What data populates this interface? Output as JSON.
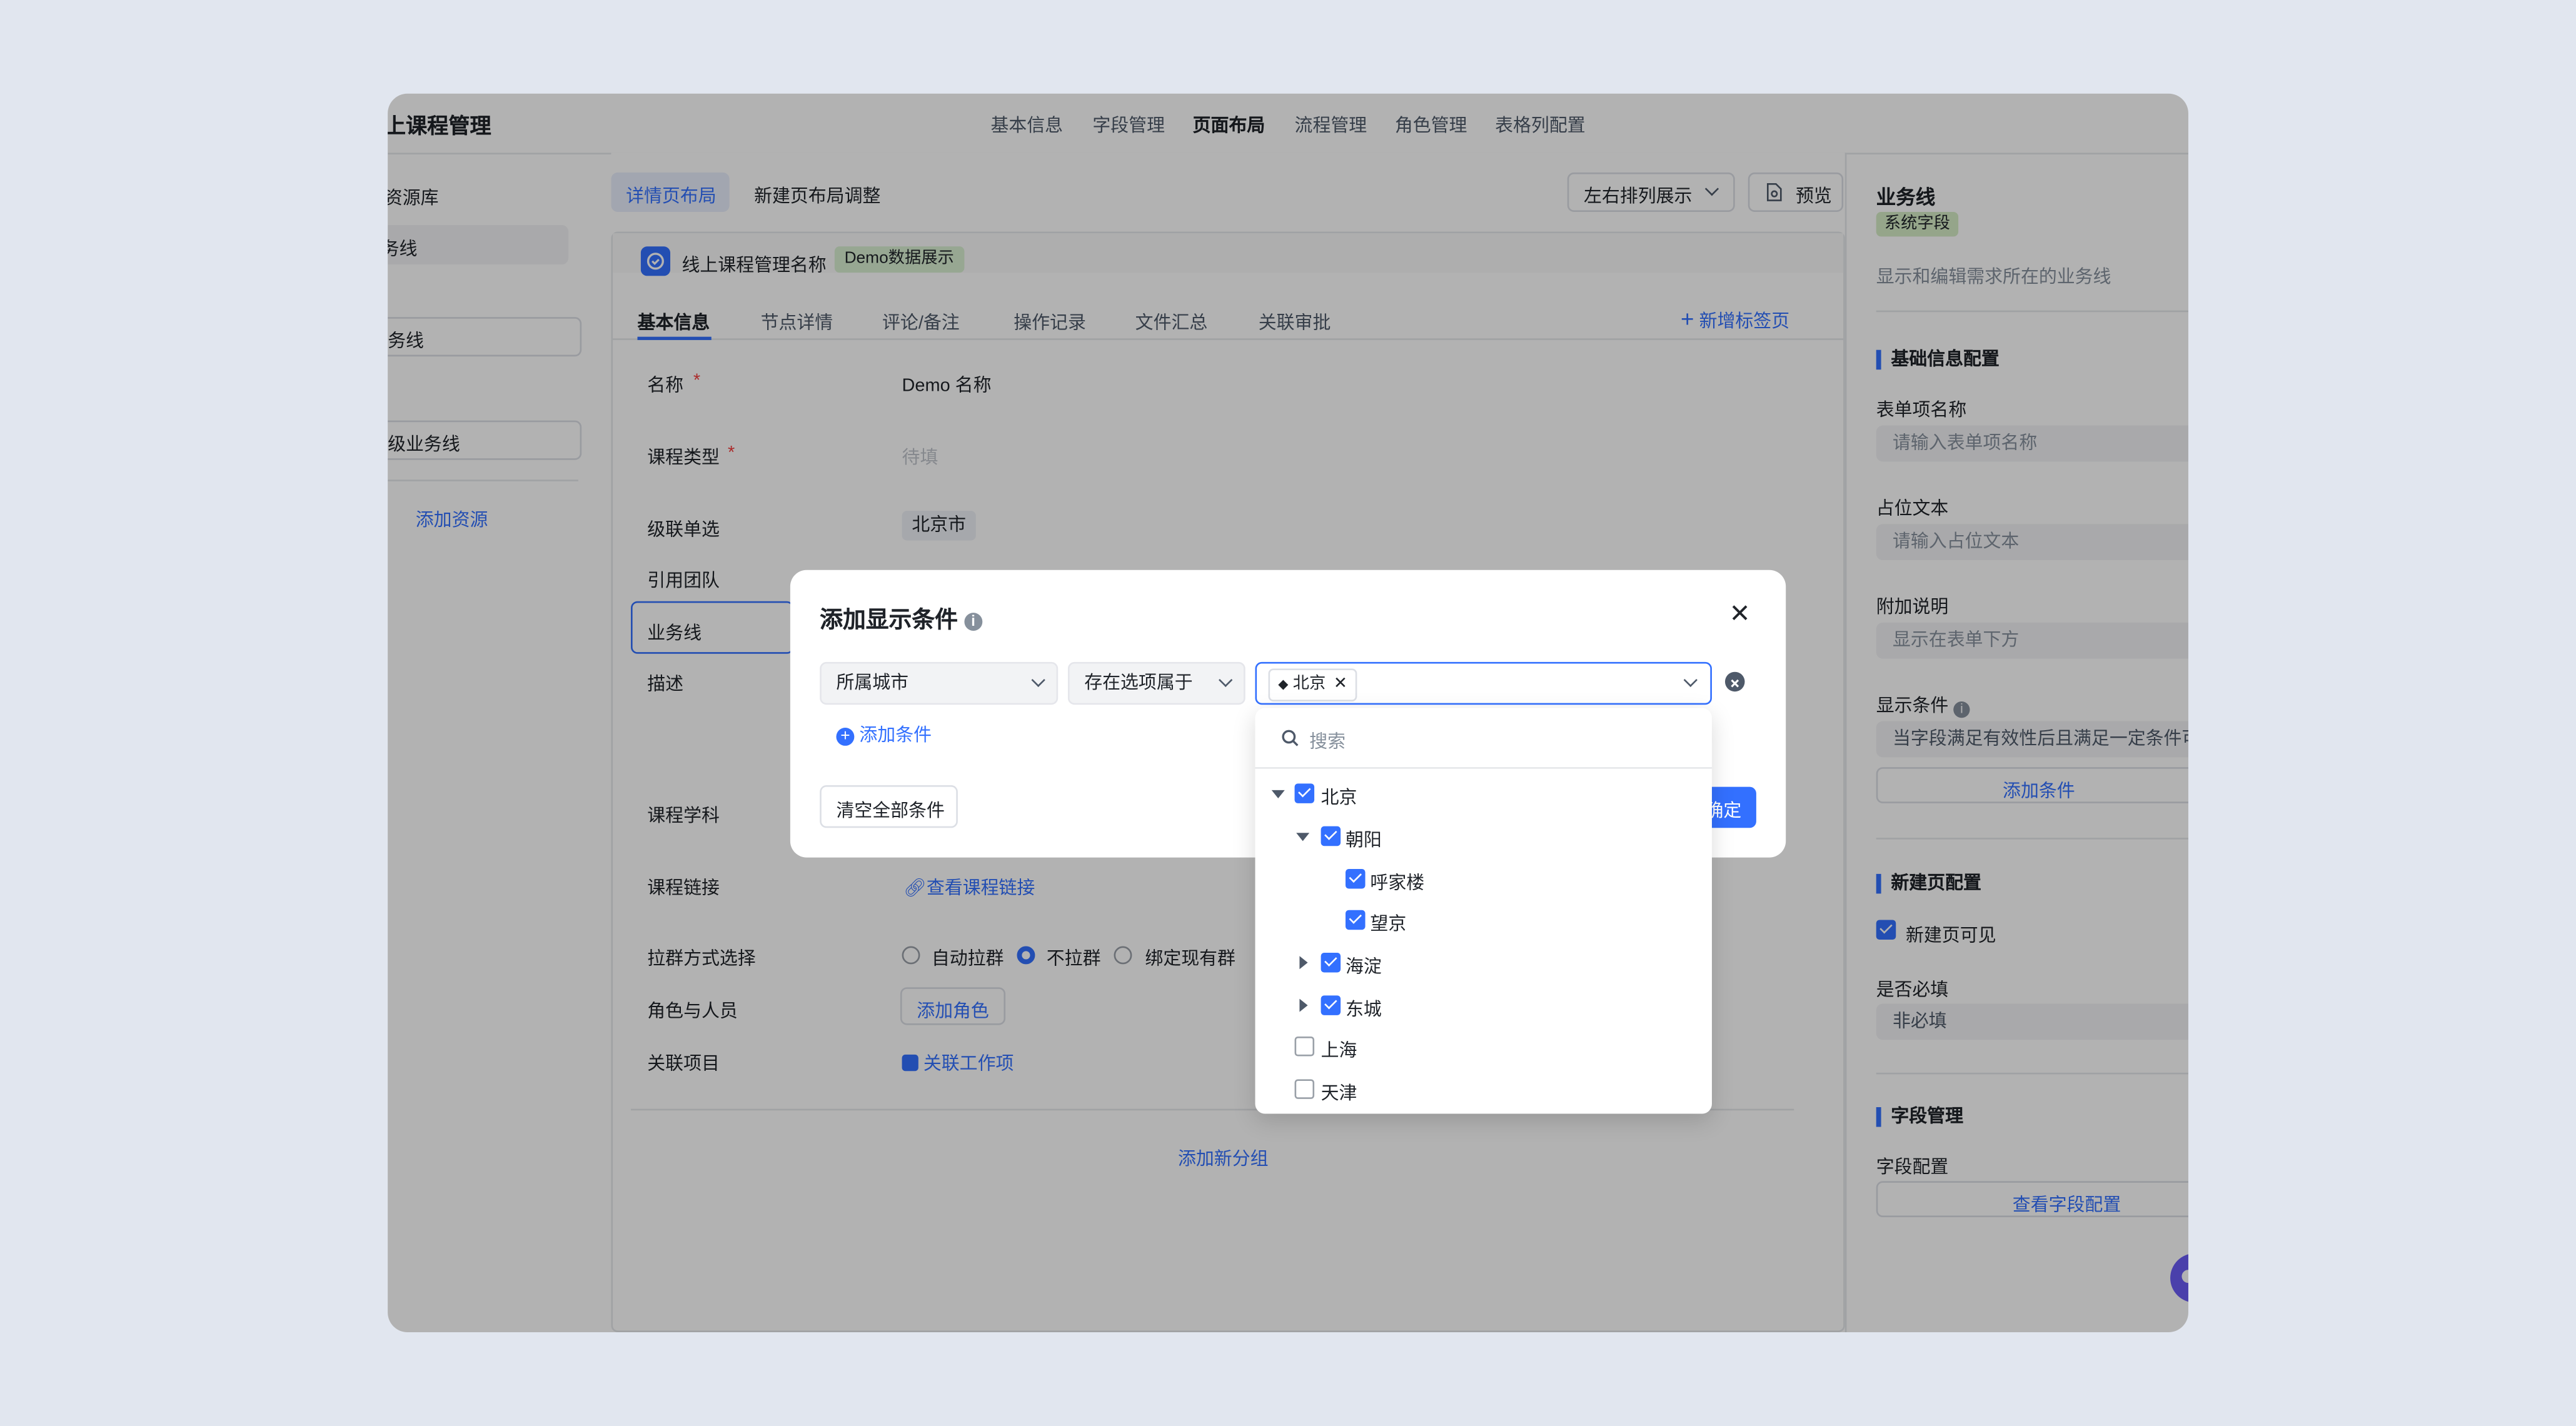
{
  "app": {
    "title": "上课程管理"
  },
  "nav": {
    "items": [
      "基本信息",
      "字段管理",
      "页面布局",
      "流程管理",
      "角色管理",
      "表格列配置"
    ],
    "active": "页面布局"
  },
  "left": {
    "resource_lib": "资源库",
    "item1": "务线",
    "item2": "务线",
    "item3": "级业务线",
    "add_resource": "添加资源"
  },
  "main": {
    "tab_detail": "详情页布局",
    "tab_new": "新建页布局调整",
    "arrange": "左右排列展示",
    "preview": "预览",
    "card_title": "线上课程管理名称",
    "demo_badge": "Demo数据展示",
    "subtabs": [
      "基本信息",
      "节点详情",
      "评论/备注",
      "操作记录",
      "文件汇总",
      "关联审批"
    ],
    "new_tab": "新增标签页",
    "fields": {
      "name_label": "名称",
      "name_value": "Demo 名称",
      "course_type_label": "课程类型",
      "course_type_placeholder": "待填",
      "cascade_label": "级联单选",
      "cascade_value": "北京市",
      "team_label": "引用团队",
      "bizline_label": "业务线",
      "desc_label": "描述",
      "subject_label": "课程学科",
      "link_label": "课程链接",
      "link_value": "查看课程链接",
      "group_label": "拉群方式选择",
      "radio_auto": "自动拉群",
      "radio_no": "不拉群",
      "radio_bind": "绑定现有群",
      "role_label": "角色与人员",
      "role_btn": "添加角色",
      "project_label": "关联项目",
      "project_value": "关联工作项"
    },
    "required_mark": "*",
    "add_group": "添加新分组"
  },
  "right": {
    "title": "业务线",
    "sys_badge": "系统字段",
    "desc": "显示和编辑需求所在的业务线",
    "basic_section": "基础信息配置",
    "form_name_label": "表单项名称",
    "form_name_ph": "请输入表单项名称",
    "placeholder_label": "占位文本",
    "placeholder_ph": "请输入占位文本",
    "extra_label": "附加说明",
    "extra_ph": "显示在表单下方",
    "cond_label": "显示条件",
    "cond_text": "当字段满足有效性后且满足一定条件可",
    "add_cond": "添加条件",
    "newpage_section": "新建页配置",
    "newpage_visible": "新建页可见",
    "required_label": "是否必填",
    "required_value": "非必填",
    "field_section": "字段管理",
    "field_config_label": "字段配置",
    "field_config_btn": "查看字段配置"
  },
  "modal": {
    "title": "添加显示条件",
    "field_select": "所属城市",
    "operator_select": "存在选项属于",
    "tag": "北京",
    "add_condition": "添加条件",
    "clear_all": "清空全部条件",
    "confirm": "确定",
    "search_ph": "搜索",
    "tree": [
      {
        "label": "北京",
        "checked": true
      },
      {
        "label": "朝阳",
        "checked": true
      },
      {
        "label": "呼家楼",
        "checked": true
      },
      {
        "label": "望京",
        "checked": true
      },
      {
        "label": "海淀",
        "checked": true
      },
      {
        "label": "东城",
        "checked": true
      },
      {
        "label": "上海",
        "checked": false
      },
      {
        "label": "天津",
        "checked": false
      }
    ]
  },
  "colors": {
    "accent": "#3370ff",
    "badge_green_bg": "#d9efd2",
    "badge_system_bg": "#d6ecc6",
    "overlay": "rgba(0,0,0,0.30)"
  }
}
